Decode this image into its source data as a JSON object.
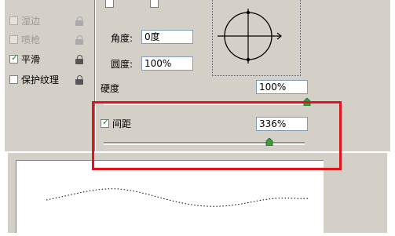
{
  "left_options": [
    {
      "label": "湿边",
      "checked": false,
      "enabled": false
    },
    {
      "label": "喷枪",
      "checked": false,
      "enabled": false
    },
    {
      "label": "平滑",
      "checked": true,
      "enabled": true
    },
    {
      "label": "保护纹理",
      "checked": false,
      "enabled": true
    }
  ],
  "angle": {
    "label": "角度:",
    "value": "0度"
  },
  "roundness": {
    "label": "圆度:",
    "value": "100%"
  },
  "hardness": {
    "label": "硬度",
    "value": "100%",
    "slider_fraction": 1.0
  },
  "spacing": {
    "label": "间距",
    "checked": true,
    "value": "336%",
    "slider_fraction": 0.82
  },
  "colors": {
    "panel": "#d4d0c8",
    "highlight": "#e0141c",
    "field_border": "#7f9db9",
    "thumb": "#3f9a3f"
  }
}
